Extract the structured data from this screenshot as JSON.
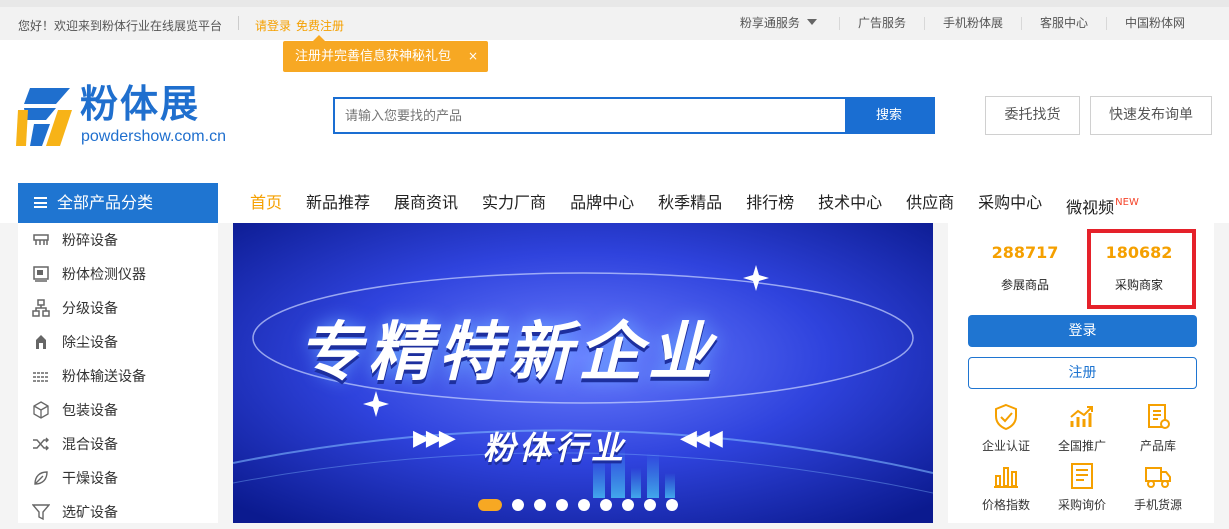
{
  "topbar": {
    "welcome": "您好！欢迎来到粉体行业在线展览平台",
    "login": "请登录",
    "register": "免费注册",
    "links": [
      "粉享通服务",
      "广告服务",
      "手机粉体展",
      "客服中心",
      "中国粉体网"
    ]
  },
  "tooltip": {
    "text": "注册并完善信息获神秘礼包",
    "close": "×"
  },
  "logo": {
    "brand": "粉体展",
    "domain": "powdershow.com.cn"
  },
  "search": {
    "placeholder": "请输入您要找的产品",
    "button": "搜索"
  },
  "header_buttons": {
    "entrust": "委托找货",
    "quick": "快速发布询单"
  },
  "nav": {
    "all_categories": "全部产品分类",
    "items": [
      "首页",
      "新品推荐",
      "展商资讯",
      "实力厂商",
      "品牌中心",
      "秋季精品",
      "排行榜",
      "技术中心",
      "供应商",
      "采购中心",
      "微视频"
    ],
    "new_badge": "NEW"
  },
  "sidebar": {
    "categories": [
      {
        "label": "粉碎设备",
        "icon": "crusher-icon"
      },
      {
        "label": "粉体检测仪器",
        "icon": "instrument-icon"
      },
      {
        "label": "分级设备",
        "icon": "classifier-icon"
      },
      {
        "label": "除尘设备",
        "icon": "dust-collector-icon"
      },
      {
        "label": "粉体输送设备",
        "icon": "conveyor-icon"
      },
      {
        "label": "包装设备",
        "icon": "package-icon"
      },
      {
        "label": "混合设备",
        "icon": "shuffle-icon"
      },
      {
        "label": "干燥设备",
        "icon": "leaf-icon"
      },
      {
        "label": "选矿设备",
        "icon": "funnel-icon"
      }
    ]
  },
  "banner": {
    "title": "专精特新企业",
    "subtitle": "粉体行业",
    "slide_count": 9,
    "active_slide": 0
  },
  "stats": {
    "goods_num": "288717",
    "goods_label": "参展商品",
    "buyers_num": "180682",
    "buyers_label": "采购商家"
  },
  "panel_buttons": {
    "login": "登录",
    "register": "注册"
  },
  "services": [
    {
      "label": "企业认证",
      "icon": "shield-check-icon"
    },
    {
      "label": "全国推广",
      "icon": "growth-chart-icon"
    },
    {
      "label": "产品库",
      "icon": "product-doc-icon"
    },
    {
      "label": "价格指数",
      "icon": "bar-chart-icon"
    },
    {
      "label": "采购询价",
      "icon": "inquiry-doc-icon"
    },
    {
      "label": "手机货源",
      "icon": "truck-icon"
    }
  ],
  "colors": {
    "accent_blue": "#1f75d1",
    "accent_orange": "#f5a000",
    "highlight_red": "#e5212a"
  }
}
